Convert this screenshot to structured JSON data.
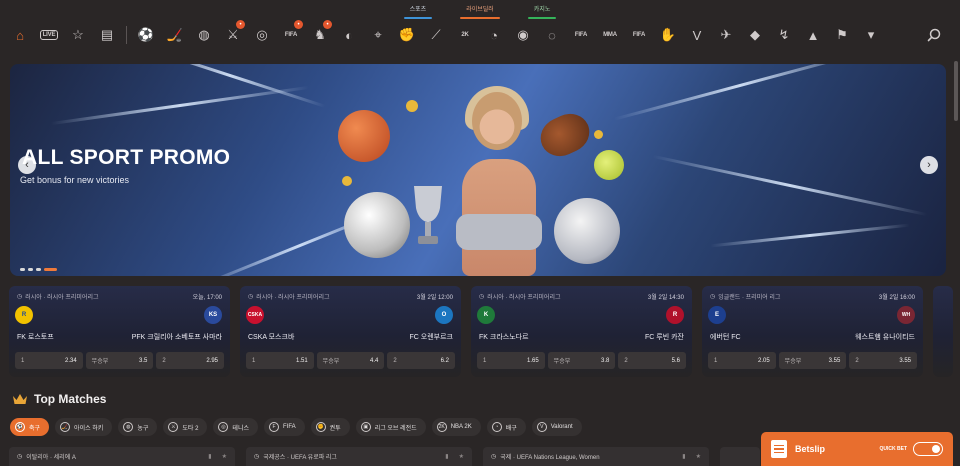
{
  "top_tabs": [
    {
      "label": "스포츠",
      "underline": "#3e93d8"
    },
    {
      "label": "라이브딜러",
      "underline": "#e86e2e"
    },
    {
      "label": "카지노",
      "underline": "#35b35a"
    }
  ],
  "sportbar": {
    "items": [
      {
        "name": "home-icon",
        "glyph": "⌂",
        "active": true
      },
      {
        "name": "live-icon",
        "text": "LIVE"
      },
      {
        "name": "favorites-icon",
        "glyph": "☆"
      },
      {
        "name": "betslip-history-icon",
        "glyph": "▤"
      },
      {
        "name": "soccer-icon",
        "glyph": "⚽"
      },
      {
        "name": "ice-hockey-icon",
        "glyph": "🏒"
      },
      {
        "name": "basketball-icon",
        "glyph": "◍"
      },
      {
        "name": "dota-icon",
        "glyph": "⚔",
        "hot": true
      },
      {
        "name": "tennis-icon",
        "glyph": "◎"
      },
      {
        "name": "fifa-icon",
        "text": "FIFA",
        "hot": true
      },
      {
        "name": "esports-fighter-icon",
        "glyph": "♞",
        "hot": true
      },
      {
        "name": "table-tennis-icon",
        "glyph": "◐"
      },
      {
        "name": "counter-strike-icon",
        "glyph": "⌖"
      },
      {
        "name": "mma-glove-icon",
        "glyph": "✊"
      },
      {
        "name": "cricket-icon",
        "glyph": "⟋"
      },
      {
        "name": "nba2k-icon",
        "text": "2K"
      },
      {
        "name": "volleyball-icon",
        "glyph": "◔"
      },
      {
        "name": "handball-icon",
        "glyph": "◉"
      },
      {
        "name": "golf-icon",
        "glyph": "◌"
      },
      {
        "name": "fifa-volta-icon",
        "text": "FIFA"
      },
      {
        "name": "mma-icon",
        "text": "MMA"
      },
      {
        "name": "fifa-penalty-icon",
        "text": "FIFA"
      },
      {
        "name": "boxing-icon",
        "glyph": "✋"
      },
      {
        "name": "valorant-icon",
        "glyph": "V"
      },
      {
        "name": "badminton-icon",
        "glyph": "✈"
      },
      {
        "name": "american-football-icon",
        "glyph": "◆"
      },
      {
        "name": "darts-icon",
        "glyph": "↯"
      },
      {
        "name": "league-icon",
        "glyph": "▲"
      },
      {
        "name": "racing-flag-icon",
        "glyph": "⚑"
      },
      {
        "name": "more-chevron-icon",
        "glyph": "▾"
      }
    ]
  },
  "banner": {
    "title": "ALL SPORT PROMO",
    "subtitle": "Get bonus for new victories",
    "prev": "‹",
    "next": "›",
    "slides": [
      false,
      false,
      false,
      true
    ]
  },
  "cards": [
    {
      "league": "러시아 · 러시아 프리미어리그",
      "time": "오늘, 17:00",
      "home": "FK 로스토프",
      "away": "PFK 크릴리아 소베토프 사마라",
      "home_logo_color": "#f2c200",
      "away_logo_color": "#2a4a9c",
      "home_abbr": "R",
      "away_abbr": "KS",
      "odds": [
        {
          "label": "1",
          "value": "2.34"
        },
        {
          "label": "무승부",
          "value": "3.5"
        },
        {
          "label": "2",
          "value": "2.95"
        }
      ]
    },
    {
      "league": "러시아 · 러시아 프리미어리그",
      "time": "3월 2일 12:00",
      "home": "CSKA 모스크바",
      "away": "FC 오렌부르크",
      "home_logo_color": "#c8102e",
      "away_logo_color": "#1c76c0",
      "home_abbr": "CSKA",
      "away_abbr": "O",
      "odds": [
        {
          "label": "1",
          "value": "1.51"
        },
        {
          "label": "무승부",
          "value": "4.4"
        },
        {
          "label": "2",
          "value": "6.2"
        }
      ]
    },
    {
      "league": "러시아 · 러시아 프리미어리그",
      "time": "3월 2일 14:30",
      "home": "FK 크라스노다르",
      "away": "FC 루빈 카잔",
      "home_logo_color": "#1f7a3a",
      "away_logo_color": "#b0112b",
      "home_abbr": "K",
      "away_abbr": "R",
      "odds": [
        {
          "label": "1",
          "value": "1.65"
        },
        {
          "label": "무승부",
          "value": "3.8"
        },
        {
          "label": "2",
          "value": "5.6"
        }
      ]
    },
    {
      "league": "잉글랜드 · 프리미어 리그",
      "time": "3월 2일 16:00",
      "home": "에버턴 FC",
      "away": "웨스트햄 유나이티드",
      "home_logo_color": "#1d3f8f",
      "away_logo_color": "#7a2633",
      "home_abbr": "E",
      "away_abbr": "WH",
      "odds": [
        {
          "label": "1",
          "value": "2.05"
        },
        {
          "label": "무승부",
          "value": "3.55"
        },
        {
          "label": "2",
          "value": "3.55"
        }
      ]
    }
  ],
  "top_matches": {
    "title": "Top Matches",
    "chips": [
      {
        "label": "축구",
        "icon": "⚽",
        "active": true
      },
      {
        "label": "아이스 하키",
        "icon": "🏒"
      },
      {
        "label": "농구",
        "icon": "◍"
      },
      {
        "label": "도타 2",
        "icon": "⚔"
      },
      {
        "label": "테니스",
        "icon": "◎"
      },
      {
        "label": "FIFA",
        "icon": "F"
      },
      {
        "label": "권투",
        "icon": "✊"
      },
      {
        "label": "리그 오브 레전드",
        "icon": "▣"
      },
      {
        "label": "NBA 2K",
        "icon": "2K"
      },
      {
        "label": "배구",
        "icon": "◔"
      },
      {
        "label": "Valorant",
        "icon": "V"
      }
    ]
  },
  "league_rows": [
    {
      "label": "이탈리아 · 세리에 A"
    },
    {
      "label": "국제공스 · UEFA 유로파 리그"
    },
    {
      "label": "국제 · UEFA Nations League, Women"
    }
  ],
  "betslip": {
    "label": "Betslip",
    "quick_bet": "QUICK BET"
  }
}
